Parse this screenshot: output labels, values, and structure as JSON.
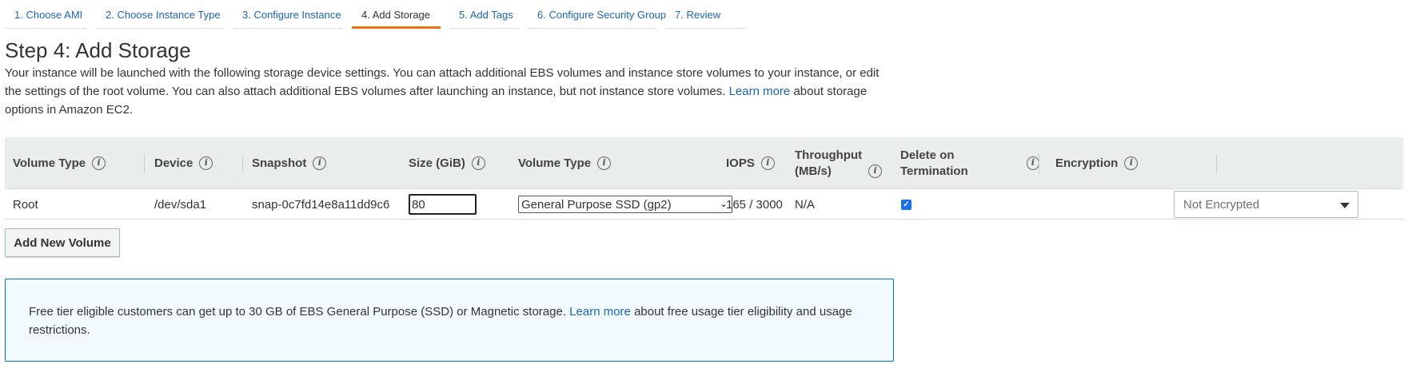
{
  "tabs": [
    {
      "label": "1. Choose AMI",
      "active": false
    },
    {
      "label": "2. Choose Instance Type",
      "active": false
    },
    {
      "label": "3. Configure Instance",
      "active": false
    },
    {
      "label": "4. Add Storage",
      "active": true
    },
    {
      "label": "5. Add Tags",
      "active": false
    },
    {
      "label": "6. Configure Security Group",
      "active": false
    },
    {
      "label": "7. Review",
      "active": false
    }
  ],
  "page": {
    "title": "Step 4: Add Storage",
    "desc_before": "Your instance will be launched with the following storage device settings. You can attach additional EBS volumes and instance store volumes to your instance, or edit the settings of the root volume. You can also attach additional EBS volumes after launching an instance, but not instance store volumes.",
    "desc_link": "Learn more",
    "desc_after": "about storage options in Amazon EC2."
  },
  "table": {
    "headers": {
      "volume_type": "Volume Type",
      "device": "Device",
      "snapshot": "Snapshot",
      "size": "Size (GiB)",
      "ebs_volume_type": "Volume Type",
      "iops": "IOPS",
      "throughput_1": "Throughput",
      "throughput_2": "(MB/s)",
      "delete": "Delete on Termination",
      "encryption": "Encryption"
    },
    "info_glyph": "i",
    "row": {
      "volume_type": "Root",
      "device": "/dev/sda1",
      "snapshot": "snap-0c7fd14e8a11dd9c6",
      "size": "80",
      "ebs_volume_type": "General Purpose SSD (gp2)",
      "iops": "165 / 3000",
      "throughput": "N/A",
      "delete_on_termination": true,
      "encryption": "Not Encrypted"
    }
  },
  "buttons": {
    "add_volume": "Add New Volume"
  },
  "notice": {
    "text_before": "Free tier eligible customers can get up to 30 GB of EBS General Purpose (SSD) or Magnetic storage.",
    "link": "Learn more",
    "text_after": "about free usage tier eligibility and usage restrictions."
  },
  "colors": {
    "accent_tab": "#ec7211",
    "link": "#1a66b3",
    "notice_border": "#0073bb",
    "notice_bg": "#f1faff",
    "checkbox": "#1a73e8"
  }
}
